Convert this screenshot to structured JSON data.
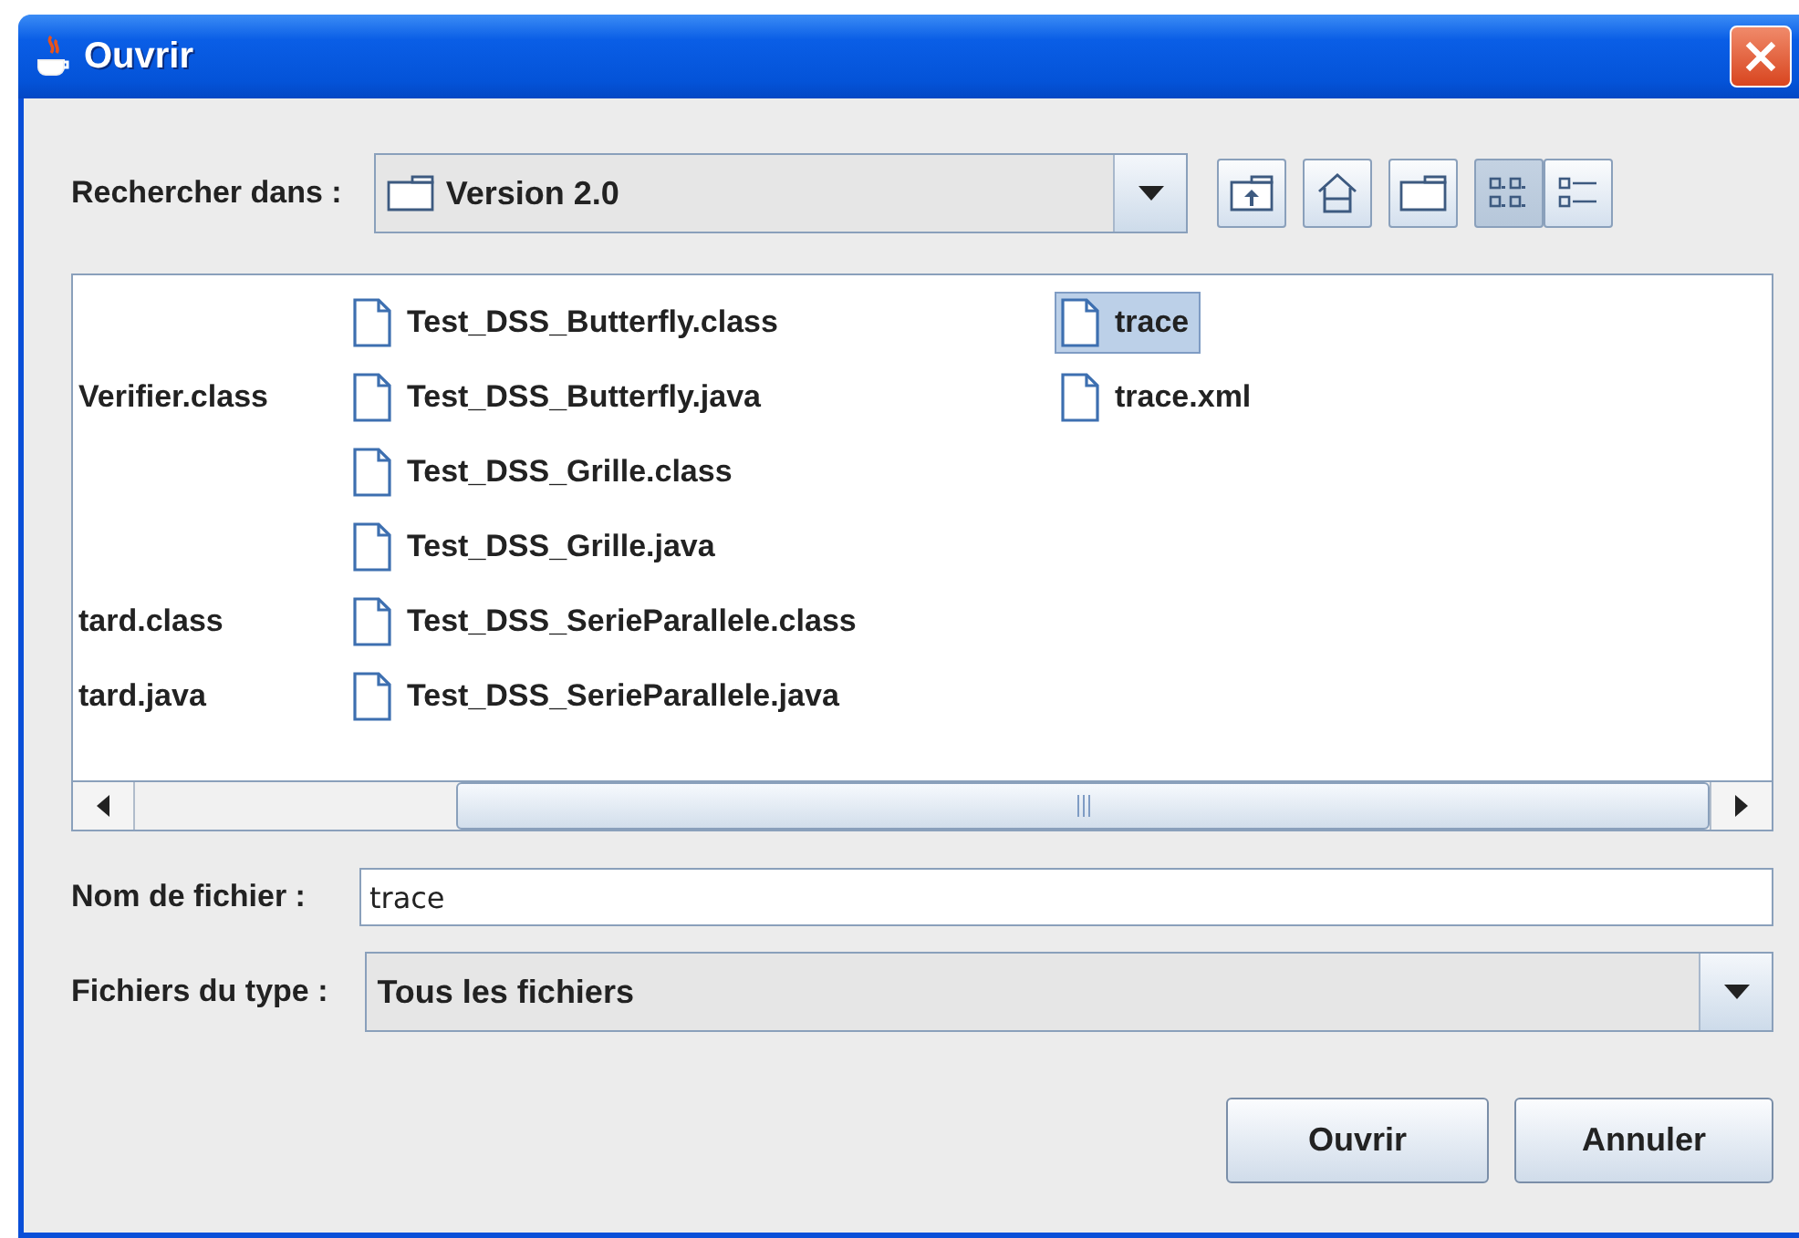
{
  "window": {
    "title": "Ouvrir"
  },
  "look_in": {
    "label": "Rechercher dans :",
    "value": "Version 2.0"
  },
  "toolbar": [
    {
      "kind": "up",
      "selected": false
    },
    {
      "kind": "home",
      "selected": false
    },
    {
      "kind": "new-folder",
      "selected": false
    },
    {
      "kind": "list",
      "selected": true
    },
    {
      "kind": "details",
      "selected": false
    }
  ],
  "file_list": {
    "columns": [
      {
        "items": [
          {
            "kind": "blank"
          },
          {
            "kind": "clipped",
            "name": "Verifier.class",
            "selected": false
          },
          {
            "kind": "blank"
          },
          {
            "kind": "blank"
          },
          {
            "kind": "clipped",
            "name": "tard.class",
            "selected": false
          },
          {
            "kind": "clipped",
            "name": "tard.java",
            "selected": false
          }
        ]
      },
      {
        "items": [
          {
            "kind": "file",
            "name": "Test_DSS_Butterfly.class",
            "selected": false
          },
          {
            "kind": "file",
            "name": "Test_DSS_Butterfly.java",
            "selected": false
          },
          {
            "kind": "file",
            "name": "Test_DSS_Grille.class",
            "selected": false
          },
          {
            "kind": "file",
            "name": "Test_DSS_Grille.java",
            "selected": false
          },
          {
            "kind": "file",
            "name": "Test_DSS_SerieParallele.class",
            "selected": false
          },
          {
            "kind": "file",
            "name": "Test_DSS_SerieParallele.java",
            "selected": false
          }
        ]
      },
      {
        "items": [
          {
            "kind": "file",
            "name": "trace",
            "selected": true
          },
          {
            "kind": "file",
            "name": "trace.xml",
            "selected": false
          }
        ]
      }
    ]
  },
  "file_name": {
    "label": "Nom de fichier :",
    "value": "trace"
  },
  "file_type": {
    "label": "Fichiers du type :",
    "value": "Tous les fichiers"
  },
  "buttons": [
    "Ouvrir",
    "Annuler"
  ]
}
